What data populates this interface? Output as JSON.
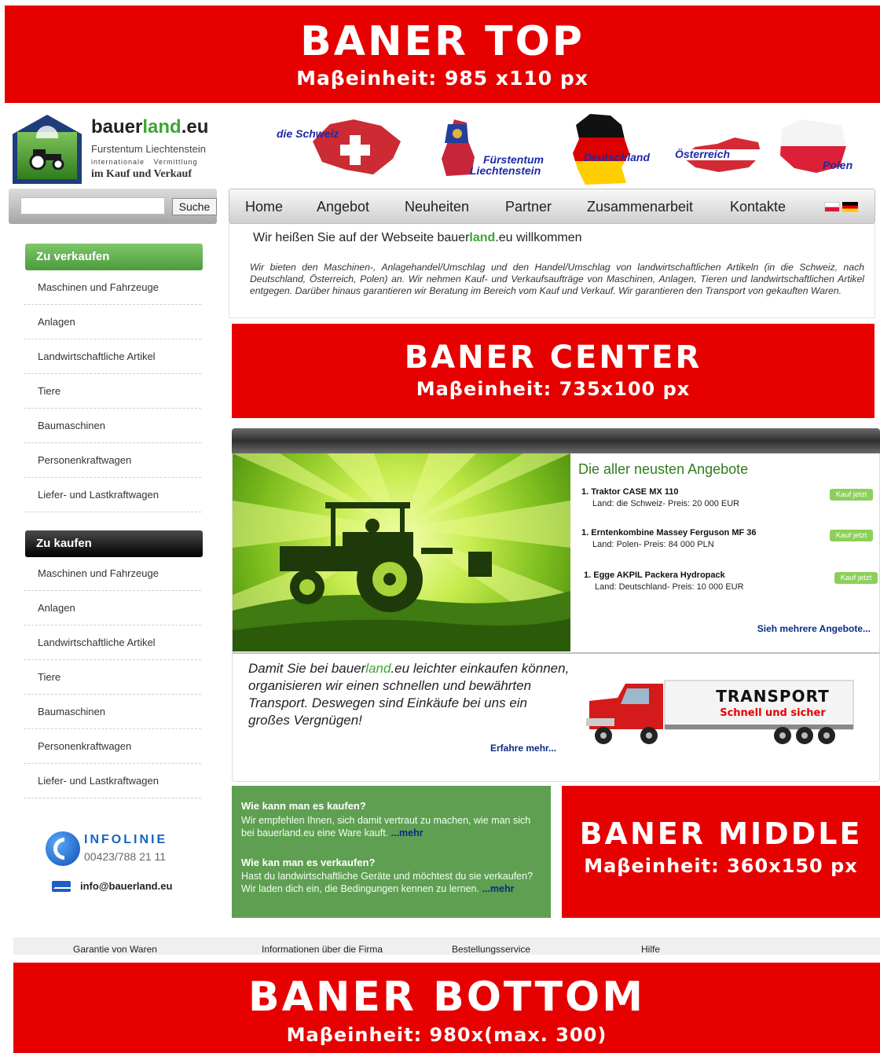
{
  "banners": {
    "top": {
      "title": "BANER TOP",
      "size": "Maβeinheit: 985 x110 px"
    },
    "center": {
      "title": "BANER CENTER",
      "size": "Maβeinheit: 735x100 px"
    },
    "middle": {
      "title": "BANER MIDDLE",
      "size": "Maβeinheit: 360x150 px"
    },
    "bottom": {
      "title": "BANER BOTTOM",
      "size": "Maβeinheit: 980x(max. 300)"
    }
  },
  "logo": {
    "brand_part1": "bauer",
    "brand_part2": "land",
    "brand_part3": ".eu",
    "line1": "Furstentum Liechtenstein",
    "line2": "internationale Vermittlung",
    "line3": "im Kauf und Verkauf"
  },
  "countries": {
    "schweiz": "die Schweiz",
    "liechtenstein_1": "Fürstentum",
    "liechtenstein_2": "Liechtenstein",
    "deutschland": "Deutschland",
    "oesterreich": "Österreich",
    "polen": "Polen"
  },
  "search": {
    "value": "",
    "button": "Suche"
  },
  "nav": {
    "items": [
      "Home",
      "Angebot",
      "Neuheiten",
      "Partner",
      "Zusammenarbeit",
      "Kontakte"
    ]
  },
  "welcome": {
    "title_part1": "Wir heißen Sie auf der Webseite bauer",
    "title_part2": "land",
    "title_part3": ".eu willkommen",
    "text": "Wir bieten den Maschinen-, Anlagehandel/Umschlag und den Handel/Umschlag von landwirtschaftlichen Artikeln (in die Schweiz, nach Deutschland, Österreich, Polen) an. Wir nehmen Kauf- und Verkaufsaufträge von Maschinen, Anlagen, Tieren und landwirtschaftlichen Artikel entgegen. Darüber hinaus garantieren wir Beratung im Bereich vom Kauf und Verkauf. Wir garantieren den Transport von gekauften Waren."
  },
  "sidebar": {
    "sell": {
      "header": "Zu verkaufen",
      "items": [
        "Maschinen und Fahrzeuge",
        "Anlagen",
        "Landwirtschaftliche Artikel",
        "Tiere",
        "Baumaschinen",
        "Personenkraftwagen",
        "Liefer- und Lastkraftwagen"
      ]
    },
    "buy": {
      "header": "Zu kaufen",
      "items": [
        "Maschinen und Fahrzeuge",
        "Anlagen",
        "Landwirtschaftliche Artikel",
        "Tiere",
        "Baumaschinen",
        "Personenkraftwagen",
        "Liefer- und Lastkraftwagen"
      ]
    },
    "infoline": {
      "label": "INFOLINIE",
      "phone": "00423/788 21 11"
    },
    "email": "info@bauerland.eu"
  },
  "offers": {
    "title": "Die aller neusten Angebote",
    "items": [
      {
        "name": "1. Traktor CASE MX 110",
        "detail": "Land: die Schweiz- Preis: 20 000 EUR",
        "button": "Kauf jetzt"
      },
      {
        "name": "1. Erntenkombine Massey Ferguson MF 36",
        "detail": "Land: Polen- Preis: 84 000 PLN",
        "button": "Kauf jetzt"
      },
      {
        "name": "1. Egge AKPIL Packera Hydropack",
        "detail": "Land: Deutschland- Preis: 10 000 EUR",
        "button": "Kauf jetzt"
      }
    ],
    "more": "Sieh mehrere Angebote..."
  },
  "transport": {
    "text_part1": "Damit Sie bei ",
    "brand_part1": "bauer",
    "brand_part2": "land",
    "brand_part3": ".eu",
    "text_part2": " leichter einkaufen können, organisieren wir einen schnellen und bewährten Transport. Deswegen sind Einkäufe bei uns ein großes Vergnügen!",
    "more": "Erfahre mehr...",
    "truck_title": "TRANSPORT",
    "truck_sub": "Schnell und sicher"
  },
  "howto": {
    "buy_title": "Wie kann man es kaufen?",
    "buy_text": "Wir empfehlen Ihnen, sich damit vertraut zu machen, wie man sich bei bauerland.eu eine Ware kauft. ",
    "buy_more": "...mehr",
    "sell_title": "Wie kan man es verkaufen?",
    "sell_text": "Hast du landwirtschaftliche Geräte und möchtest du sie verkaufen? Wir laden dich ein, die Bedingungen kennen zu lernen. ",
    "sell_more": "...mehr"
  },
  "footer": {
    "links": [
      "Garantie von Waren",
      "Informationen über die Firma",
      "Bestellungsservice",
      "Hilfe"
    ]
  },
  "colors": {
    "banner_red": "#e60000",
    "brand_green": "#3fa535",
    "link_blue": "#0b2a86",
    "howto_green": "#5f9f52"
  }
}
